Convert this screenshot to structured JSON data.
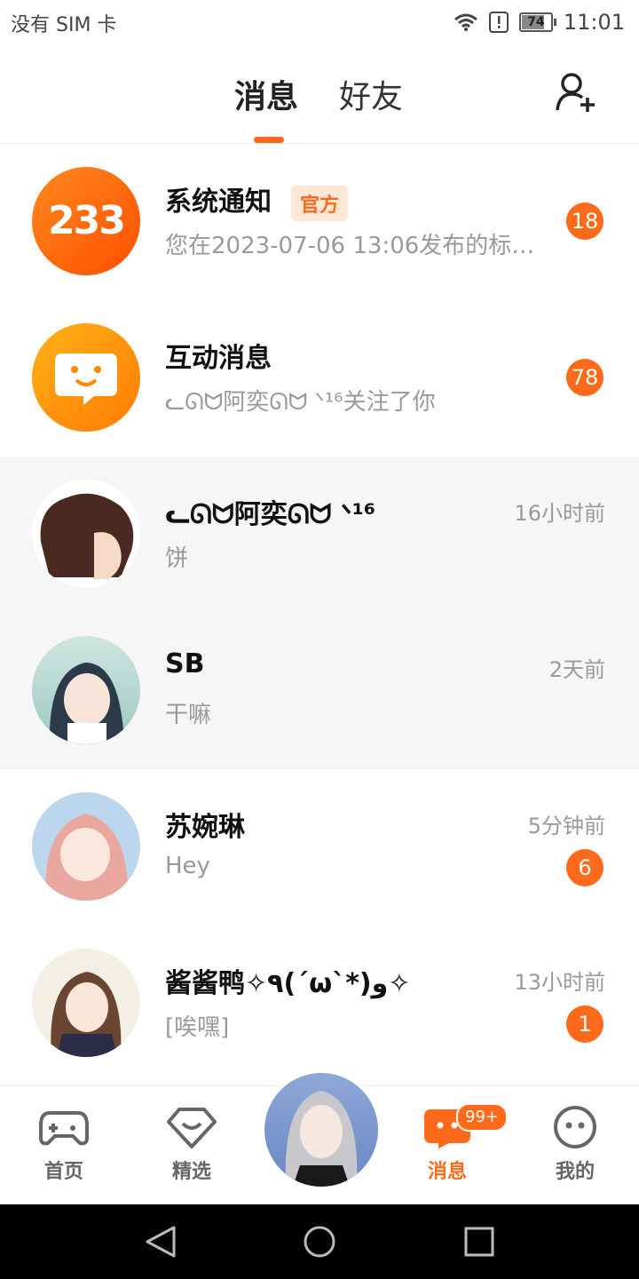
{
  "status": {
    "carrier": "没有 SIM 卡",
    "battery": "74",
    "time": "11:01"
  },
  "header": {
    "tabs": [
      {
        "label": "消息"
      },
      {
        "label": "好友"
      }
    ]
  },
  "conversations": [
    {
      "name": "系统通知",
      "tag": "官方",
      "preview": "您在2023-07-06 13:06发布的标题…",
      "badge": "18",
      "time": "",
      "avatar": "233"
    },
    {
      "name": "互动消息",
      "preview": "ᓚᘏᗢ阿奕ᘏᗢ ᐠ¹⁶关注了你",
      "badge": "78",
      "time": ""
    },
    {
      "name": "ᓚᘏᗢ阿奕ᘏᗢ ᐠ¹⁶",
      "preview": "饼",
      "badge": "",
      "time": "16小时前"
    },
    {
      "name": "SB",
      "preview": "干嘛",
      "badge": "",
      "time": "2天前"
    },
    {
      "name": "苏婉琳",
      "preview": "Hey",
      "badge": "6",
      "time": "5分钟前"
    },
    {
      "name": "酱酱鸭✧٩(ˊωˋ*)و✧",
      "preview": "[唉嘿]",
      "badge": "1",
      "time": "13小时前"
    }
  ],
  "bottom_nav": {
    "items": [
      {
        "label": "首页"
      },
      {
        "label": "精选"
      },
      {
        "label": "消息"
      },
      {
        "label": "我的"
      }
    ],
    "message_badge": "99+"
  },
  "colors": {
    "accent": "#ff6a1a"
  }
}
